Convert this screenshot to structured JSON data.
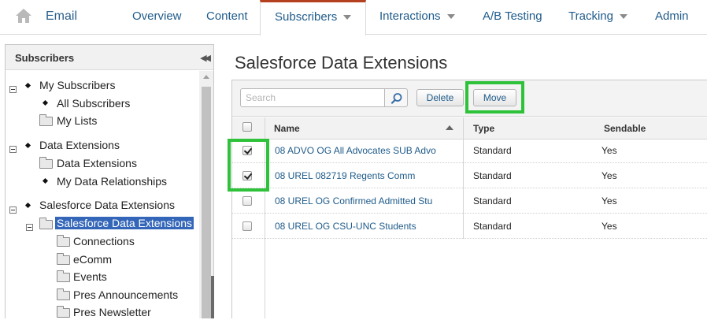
{
  "nav": {
    "app_title": "Email",
    "items": [
      {
        "label": "Overview",
        "caret": false
      },
      {
        "label": "Content",
        "caret": false
      },
      {
        "label": "Subscribers",
        "caret": true,
        "active": true
      },
      {
        "label": "Interactions",
        "caret": true
      },
      {
        "label": "A/B Testing",
        "caret": false
      },
      {
        "label": "Tracking",
        "caret": true
      },
      {
        "label": "Admin",
        "caret": false
      }
    ],
    "active_accent": "#b5401f"
  },
  "sidebar": {
    "title": "Subscribers",
    "collapse_icon": "double-chevron-left-icon",
    "tree": [
      {
        "label": "My Subscribers",
        "icon": "bullet"
      },
      {
        "label": "All Subscribers",
        "icon": "bullet"
      },
      {
        "label": "My Lists",
        "icon": "folder-icon"
      },
      {
        "label": "Data Extensions",
        "icon": "bullet"
      },
      {
        "label": "Data Extensions",
        "icon": "folder-icon"
      },
      {
        "label": "My Data Relationships",
        "icon": "bullet"
      },
      {
        "label": "Salesforce Data Extensions",
        "icon": "bullet"
      },
      {
        "label": "Salesforce Data Extensions",
        "icon": "folder-icon",
        "selected": true
      },
      {
        "label": "Connections",
        "icon": "folder-icon"
      },
      {
        "label": "eComm",
        "icon": "folder-icon"
      },
      {
        "label": "Events",
        "icon": "folder-icon"
      },
      {
        "label": "Pres Announcements",
        "icon": "folder-icon"
      },
      {
        "label": "Pres Newsletter",
        "icon": "folder-icon"
      }
    ],
    "selected_color": "#3366b8"
  },
  "main": {
    "title": "Salesforce Data Extensions",
    "toolbar": {
      "search_placeholder": "Search",
      "delete_label": "Delete",
      "move_label": "Move"
    },
    "table": {
      "columns": [
        "Name",
        "Type",
        "Sendable"
      ],
      "sort_column": "Name",
      "sort_direction": "descending",
      "rows": [
        {
          "checked": true,
          "name": "08 ADVO OG All Advocates SUB Advo",
          "type": "Standard",
          "sendable": "Yes"
        },
        {
          "checked": true,
          "name": "08 UREL 082719 Regents Comm",
          "type": "Standard",
          "sendable": "Yes"
        },
        {
          "checked": false,
          "name": "08 UREL OG Confirmed Admitted Stu",
          "type": "Standard",
          "sendable": "Yes"
        },
        {
          "checked": false,
          "name": "08 UREL OG CSU-UNC Students",
          "type": "Standard",
          "sendable": "Yes"
        }
      ]
    },
    "highlight_color": "#2ec23b",
    "link_color": "#1f5b8a"
  }
}
